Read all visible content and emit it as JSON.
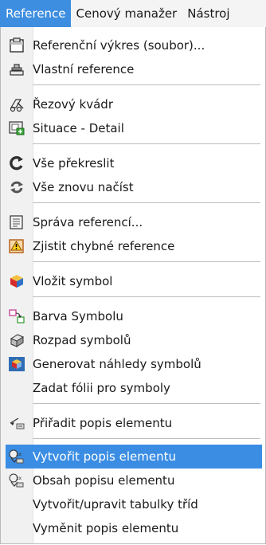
{
  "menubar": {
    "items": [
      {
        "label": "Reference"
      },
      {
        "label": "Cenový manažer"
      },
      {
        "label": "Nástroj"
      }
    ]
  },
  "dropdown": {
    "items": [
      {
        "label": "Referenční výkres (soubor)...",
        "icon": "clipboard-icon"
      },
      {
        "label": "Vlastní reference",
        "icon": "stamp-icon"
      },
      {
        "label": "Řezový kvádr",
        "icon": "section-box-icon"
      },
      {
        "label": "Situace - Detail",
        "icon": "situation-detail-icon"
      },
      {
        "label": "Vše překreslit",
        "icon": "redraw-icon"
      },
      {
        "label": "Vše znovu načíst",
        "icon": "reload-icon"
      },
      {
        "label": "Správa referencí...",
        "icon": "reference-manager-icon"
      },
      {
        "label": "Zjistit chybné reference",
        "icon": "error-reference-icon"
      },
      {
        "label": "Vložit symbol",
        "icon": "insert-symbol-icon"
      },
      {
        "label": "Barva Symbolu",
        "icon": "symbol-color-icon"
      },
      {
        "label": "Rozpad symbolů",
        "icon": "explode-symbol-icon"
      },
      {
        "label": "Generovat náhledy symbolů",
        "icon": "generate-previews-icon"
      },
      {
        "label": "Zadat fólii pro symboly",
        "icon": ""
      },
      {
        "label": "Přiřadit popis elementu",
        "icon": "assign-label-icon"
      },
      {
        "label": "Vytvořit popis elementu",
        "icon": "create-label-icon"
      },
      {
        "label": "Obsah popisu elementu",
        "icon": "label-content-icon"
      },
      {
        "label": "Vytvořit/upravit tabulky tříd",
        "icon": ""
      },
      {
        "label": "Vyměnit popis elementu",
        "icon": ""
      }
    ]
  },
  "colors": {
    "highlight": "#3a8de3",
    "menubar_active": "#3d8ee0"
  }
}
